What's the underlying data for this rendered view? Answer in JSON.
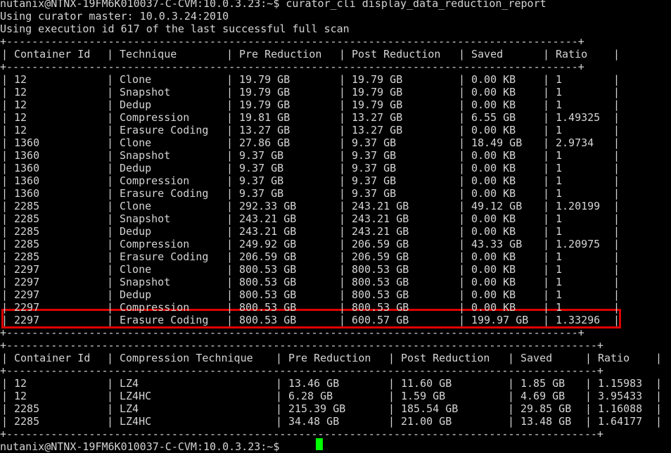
{
  "terminal": {
    "header_lines": [
      "nutanix@NTNX-19FM6K010037-C-CVM:10.0.3.23:~$ curator_cli display_data_reduction_report",
      "Using curator master: 10.0.3.24:2010",
      "Using execution id 617 of the last successful full scan"
    ],
    "prompt": "nutanix@NTNX-19FM6K010037-C-CVM:10.0.3.23:~$ ",
    "cursor_color": "#00ff00",
    "highlight_color": "#e00000"
  },
  "table1": {
    "border": "+------------------------------------------------------------------------------------------+",
    "headers": [
      "Container Id",
      "Technique",
      "Pre Reduction",
      "Post Reduction",
      "Saved",
      "Ratio"
    ],
    "rows": [
      [
        "12",
        "Clone",
        "19.79 GB",
        "19.79 GB",
        "0.00 KB",
        "1"
      ],
      [
        "12",
        "Snapshot",
        "19.79 GB",
        "19.79 GB",
        "0.00 KB",
        "1"
      ],
      [
        "12",
        "Dedup",
        "19.79 GB",
        "19.79 GB",
        "0.00 KB",
        "1"
      ],
      [
        "12",
        "Compression",
        "19.81 GB",
        "13.27 GB",
        "6.55 GB",
        "1.49325"
      ],
      [
        "12",
        "Erasure Coding",
        "13.27 GB",
        "13.27 GB",
        "0.00 KB",
        "1"
      ],
      [
        "1360",
        "Clone",
        "27.86 GB",
        "9.37 GB",
        "18.49 GB",
        "2.9734"
      ],
      [
        "1360",
        "Snapshot",
        "9.37 GB",
        "9.37 GB",
        "0.00 KB",
        "1"
      ],
      [
        "1360",
        "Dedup",
        "9.37 GB",
        "9.37 GB",
        "0.00 KB",
        "1"
      ],
      [
        "1360",
        "Compression",
        "9.37 GB",
        "9.37 GB",
        "0.00 KB",
        "1"
      ],
      [
        "1360",
        "Erasure Coding",
        "9.37 GB",
        "9.37 GB",
        "0.00 KB",
        "1"
      ],
      [
        "2285",
        "Clone",
        "292.33 GB",
        "243.21 GB",
        "49.12 GB",
        "1.20199"
      ],
      [
        "2285",
        "Snapshot",
        "243.21 GB",
        "243.21 GB",
        "0.00 KB",
        "1"
      ],
      [
        "2285",
        "Dedup",
        "243.21 GB",
        "243.21 GB",
        "0.00 KB",
        "1"
      ],
      [
        "2285",
        "Compression",
        "249.92 GB",
        "206.59 GB",
        "43.33 GB",
        "1.20975"
      ],
      [
        "2285",
        "Erasure Coding",
        "206.59 GB",
        "206.59 GB",
        "0.00 KB",
        "1"
      ],
      [
        "2297",
        "Clone",
        "800.53 GB",
        "800.53 GB",
        "0.00 KB",
        "1"
      ],
      [
        "2297",
        "Snapshot",
        "800.53 GB",
        "800.53 GB",
        "0.00 KB",
        "1"
      ],
      [
        "2297",
        "Dedup",
        "800.53 GB",
        "800.53 GB",
        "0.00 KB",
        "1"
      ],
      [
        "2297",
        "Compression",
        "800.53 GB",
        "800.53 GB",
        "0.00 KB",
        "1"
      ],
      [
        "2297",
        "Erasure Coding",
        "800.53 GB",
        "600.57 GB",
        "199.97 GB",
        "1.33296"
      ]
    ]
  },
  "table2": {
    "border": "+---------------------------------------------------------------------------------------------+",
    "headers": [
      "Container Id",
      "Compression Technique",
      "Pre Reduction",
      "Post Reduction",
      "Saved",
      "Ratio"
    ],
    "rows": [
      [
        "12",
        "LZ4",
        "13.46 GB",
        "11.60 GB",
        "1.85 GB",
        "1.15983"
      ],
      [
        "12",
        "LZ4HC",
        "6.28 GB",
        "1.59 GB",
        "4.69 GB",
        "3.95433"
      ],
      [
        "2285",
        "LZ4",
        "215.39 GB",
        "185.54 GB",
        "29.85 GB",
        "1.16088"
      ],
      [
        "2285",
        "LZ4HC",
        "34.48 GB",
        "21.00 GB",
        "13.48 GB",
        "1.64177"
      ]
    ]
  }
}
